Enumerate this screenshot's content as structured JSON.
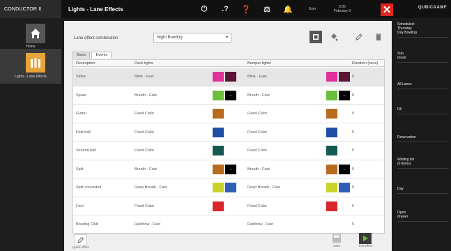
{
  "topbar": {
    "brand": "CONDUCTOR II",
    "title": "Lights - Lane Effects",
    "icons": [
      "power-icon",
      "help-question-icon",
      "info-icon",
      "scale-icon",
      "bell-icon"
    ],
    "icon_glyphs": [
      "⏻",
      ".?",
      "❓",
      "⚖",
      "🔔"
    ],
    "user": "User",
    "time_line1": "9:35",
    "time_line2": "February 9",
    "close_glyph": "✕",
    "logo": "QUBICAAMF"
  },
  "leftbar": {
    "items": [
      {
        "label": "Home",
        "icon": "home-icon"
      },
      {
        "label": "Lights - Lane Effects",
        "icon": "lights-icon"
      }
    ]
  },
  "main": {
    "combo_label": "Lane effect combination",
    "combo_value": "Night Bowling",
    "tools": [
      "add-icon",
      "paint-bucket-icon",
      "edit-icon",
      "delete-icon"
    ],
    "tabs": [
      "Basic",
      "Events"
    ],
    "active_tab": 1,
    "columns": [
      "Description",
      "Deck lights",
      "Bumper lights",
      "Duration (secs)"
    ],
    "rows": [
      {
        "desc": "Strike",
        "deck": "Blink - Fast",
        "bumper": "Blink - Fast",
        "dur": "5",
        "deck_colors": [
          "#e0309a",
          "#5a1436"
        ],
        "bumper_colors": [
          "#e0309a",
          "#5a1436"
        ],
        "selected": true
      },
      {
        "desc": "Spare",
        "deck": "Breath - Fast",
        "bumper": "Breath - Fast",
        "dur": "5",
        "deck_colors": [
          "#6cbf3b",
          "arrow"
        ],
        "bumper_colors": [
          "#6cbf3b",
          "arrow"
        ],
        "selected": false
      },
      {
        "desc": "Gutter",
        "deck": "Fixed Color",
        "bumper": "Fixed Color",
        "dur": "5",
        "deck_colors": [
          "#b86a1e"
        ],
        "bumper_colors": [
          "#b86a1e"
        ],
        "selected": false
      },
      {
        "desc": "First ball",
        "deck": "Fixed Color",
        "bumper": "Fixed Color",
        "dur": "5",
        "deck_colors": [
          "#1f4ea3"
        ],
        "bumper_colors": [
          "#1f4ea3"
        ],
        "selected": false
      },
      {
        "desc": "Second ball",
        "deck": "Fixed Color",
        "bumper": "Fixed Color",
        "dur": "5",
        "deck_colors": [
          "#145a52"
        ],
        "bumper_colors": [
          "#145a52"
        ],
        "selected": false
      },
      {
        "desc": "Split",
        "deck": "Breath - Fast",
        "bumper": "Breath - Fast",
        "dur": "5",
        "deck_colors": [
          "#b86a1e",
          "arrow"
        ],
        "bumper_colors": [
          "#b86a1e",
          "arrow"
        ],
        "selected": false
      },
      {
        "desc": "Split converted",
        "deck": "Deep Breath - Fast",
        "bumper": "Deep Breath - Fast",
        "dur": "5",
        "deck_colors": [
          "#c9d42a",
          "#2d5fb8"
        ],
        "bumper_colors": [
          "#c9d42a",
          "#2d5fb8"
        ],
        "selected": false
      },
      {
        "desc": "Foul",
        "deck": "Fixed Color",
        "bumper": "Fixed Color",
        "dur": "5",
        "deck_colors": [
          "#d8262a"
        ],
        "bumper_colors": [
          "#d8262a"
        ],
        "selected": false
      },
      {
        "desc": "Bowling Club",
        "deck": "Rainbow - Fast",
        "bumper": "Rainbow - Fast",
        "dur": "5",
        "deck_colors": [],
        "bumper_colors": [],
        "selected": false
      }
    ],
    "bottom": {
      "left_button": "Quick effect",
      "save": "Save",
      "test": "Test effect"
    }
  },
  "rightbar": {
    "items": [
      "Scheduled:\nThursday\nDay Bowling",
      "Sub\nmode",
      "All Lanes",
      "Fill",
      "Reservation",
      "Waiting list\n(0 items)",
      "Day",
      "Open\ndrawer"
    ]
  },
  "colors": {
    "accent_orange": "#e7a43a",
    "close_red": "#e1251b"
  }
}
